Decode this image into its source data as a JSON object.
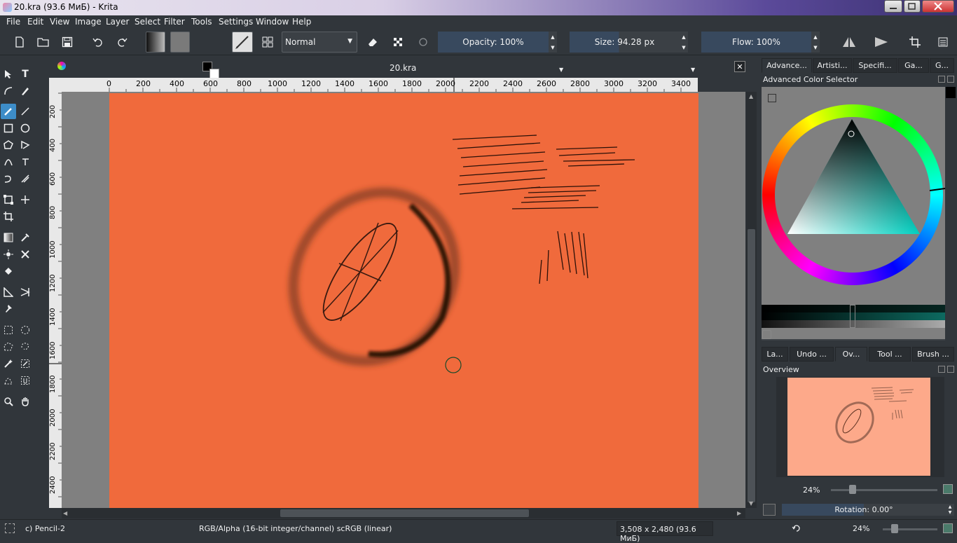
{
  "window": {
    "title": "20.kra (93.6 МиБ)  - Krita",
    "minimize_icon": "minimize-icon",
    "maximize_icon": "maximize-icon",
    "close_icon": "close-icon"
  },
  "menu": [
    "File",
    "Edit",
    "View",
    "Image",
    "Layer",
    "Select",
    "Filter",
    "Tools",
    "Settings",
    "Window",
    "Help"
  ],
  "toolbar": {
    "blend_mode": "Normal",
    "opacity_label": "Opacity: 100%",
    "size_label": "Size: 94.28 px",
    "flow_label": "Flow: 100%"
  },
  "document": {
    "tab_title": "20.kra",
    "canvas_color": "#f06a3c",
    "hruler_ticks": [
      "0",
      "200",
      "400",
      "600",
      "800",
      "1000",
      "1200",
      "1400",
      "1600",
      "1800",
      "2000",
      "2200",
      "2400",
      "2600",
      "2800",
      "3000",
      "3200",
      "3400"
    ],
    "vruler_ticks": [
      "200",
      "400",
      "600",
      "800",
      "1000",
      "1200",
      "1400",
      "1600",
      "1800",
      "2000",
      "2200",
      "2400"
    ]
  },
  "dockers": {
    "top_tabs": [
      "Advance...",
      "Artisti...",
      "Specifi...",
      "Ga...",
      "G..."
    ],
    "color_selector_title": "Advanced Color Selector",
    "bottom_tabs": [
      "La...",
      "Undo ...",
      "Ov...",
      "Tool ...",
      "Brush ..."
    ],
    "overview_title": "Overview",
    "overview_zoom": "24%",
    "rotation_label": "Rotation: 0.00°"
  },
  "status": {
    "brush_preset": "c) Pencil-2",
    "color_space": "RGB/Alpha (16-bit integer/channel)  scRGB (linear)",
    "image_size": "3,508 x 2,480 (93.6 МиБ)",
    "zoom": "24%"
  }
}
